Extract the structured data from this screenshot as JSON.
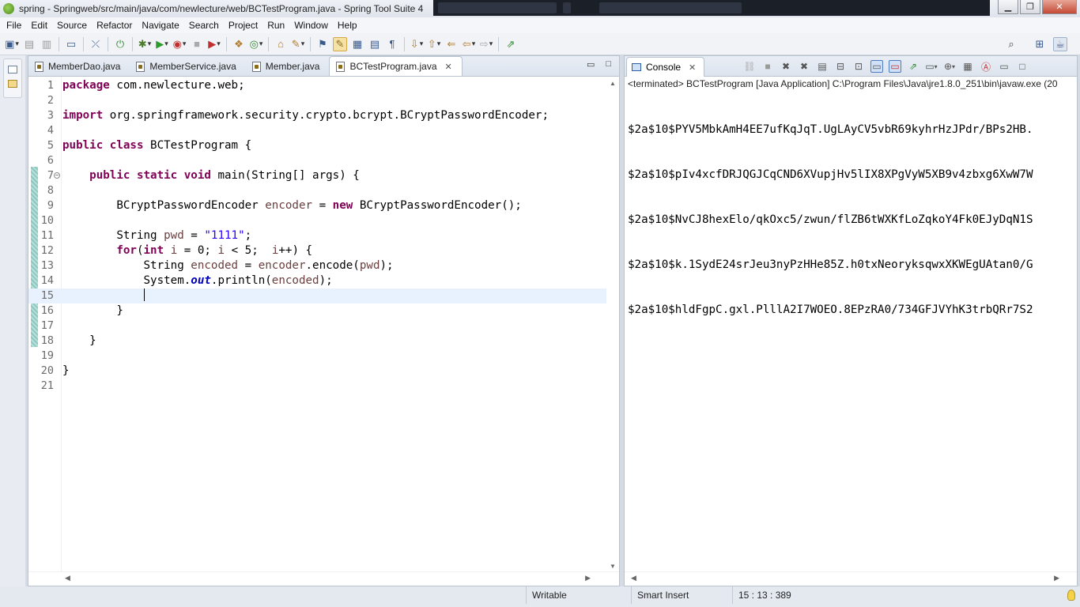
{
  "window": {
    "title": "spring - Springweb/src/main/java/com/newlecture/web/BCTestProgram.java - Spring Tool Suite 4",
    "minimize": "▁",
    "restore": "❐",
    "close": "✕"
  },
  "menu": [
    "File",
    "Edit",
    "Source",
    "Refactor",
    "Navigate",
    "Search",
    "Project",
    "Run",
    "Window",
    "Help"
  ],
  "editor": {
    "tabs": [
      {
        "label": "MemberDao.java",
        "active": false
      },
      {
        "label": "MemberService.java",
        "active": false
      },
      {
        "label": "Member.java",
        "active": false
      },
      {
        "label": "BCTestProgram.java",
        "active": true
      }
    ],
    "tab_close": "✕",
    "minimize": "▭",
    "maximize": "□",
    "line_numbers": [
      "1",
      "2",
      "3",
      "4",
      "5",
      "6",
      "7",
      "8",
      "9",
      "10",
      "11",
      "12",
      "13",
      "14",
      "15",
      "16",
      "17",
      "18",
      "19",
      "20",
      "21"
    ],
    "fold_marker": "−"
  },
  "console": {
    "tab_label": "Console",
    "tab_close": "✕",
    "status": "<terminated> BCTestProgram [Java Application] C:\\Program Files\\Java\\jre1.8.0_251\\bin\\javaw.exe  (20",
    "output": [
      "$2a$10$PYV5MbkAmH4EE7ufKqJqT.UgLAyCV5vbR69kyhrHzJPdr/BPs2HB.",
      "$2a$10$pIv4xcfDRJQGJCqCND6XVupjHv5lIX8XPgVyW5XB9v4zbxg6XwW7W",
      "$2a$10$NvCJ8hexElo/qkOxc5/zwun/flZB6tWXKfLoZqkoY4Fk0EJyDqN1S",
      "$2a$10$k.1SydE24srJeu3nyPzHHe85Z.h0txNeoryksqwxXKWEgUAtan0/G",
      "$2a$10$hldFgpC.gxl.PlllA2I7WOEO.8EPzRA0/734GFJVYhK3trbQRr7S2"
    ]
  },
  "statusbar": {
    "writable": "Writable",
    "insert_mode": "Smart Insert",
    "cursor_pos": "15 : 13 : 389"
  },
  "colors": {
    "keyword": "#7f0055",
    "string": "#2a00ff",
    "local_var": "#6a3e3e",
    "static_field": "#0000c0",
    "current_line": "#e8f2fe"
  }
}
